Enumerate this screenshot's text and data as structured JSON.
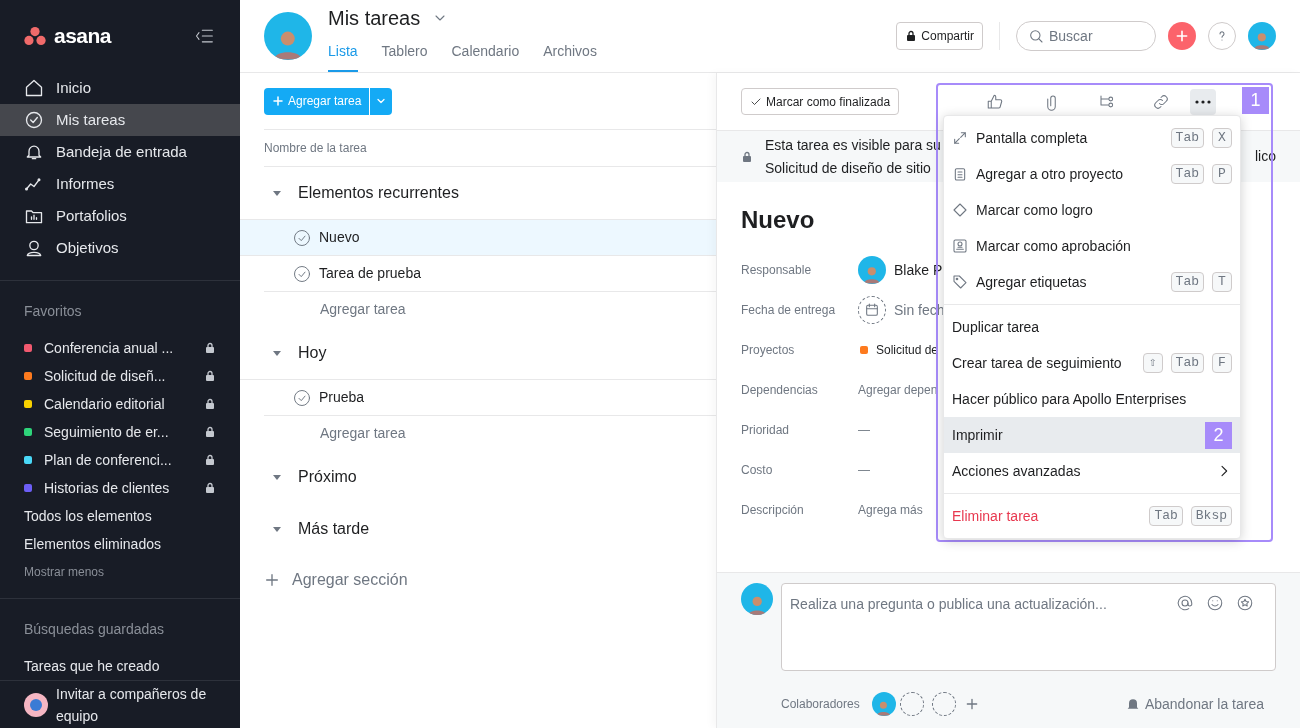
{
  "sidebar": {
    "logo": "asana",
    "nav": [
      {
        "label": "Inicio",
        "selected": false
      },
      {
        "label": "Mis tareas",
        "selected": true
      },
      {
        "label": "Bandeja de entrada",
        "selected": false
      },
      {
        "label": "Informes",
        "selected": false
      },
      {
        "label": "Portafolios",
        "selected": false
      },
      {
        "label": "Objetivos",
        "selected": false
      }
    ],
    "favorites_title": "Favoritos",
    "favorites": [
      {
        "label": "Conferencia anual ...",
        "color": "#f1596f"
      },
      {
        "label": "Solicitud de diseñ...",
        "color": "#fd7a1e"
      },
      {
        "label": "Calendario editorial",
        "color": "#f8d100"
      },
      {
        "label": "Seguimiento de er...",
        "color": "#2ed47a"
      },
      {
        "label": "Plan de conferenci...",
        "color": "#4ad8f7"
      },
      {
        "label": "Historias de clientes",
        "color": "#6c5ef6"
      }
    ],
    "links": [
      "Todos los elementos",
      "Elementos eliminados"
    ],
    "show_less": "Mostrar menos",
    "saved_title": "Búsquedas guardadas",
    "saved": [
      "Tareas que he creado"
    ],
    "invite": "Invitar a compañeros de equipo"
  },
  "header": {
    "title": "Mis tareas",
    "tabs": [
      {
        "label": "Lista",
        "selected": true
      },
      {
        "label": "Tablero",
        "selected": false
      },
      {
        "label": "Calendario",
        "selected": false
      },
      {
        "label": "Archivos",
        "selected": false
      }
    ],
    "share": "Compartir",
    "search": {
      "placeholder": "Buscar"
    }
  },
  "list": {
    "add_button": "Agregar tarea",
    "column": "Nombre de la tarea",
    "add_section": "Agregar sección",
    "sections": [
      {
        "title": "Elementos recurrentes",
        "tasks": [
          {
            "name": "Nuevo",
            "selected": true
          },
          {
            "name": "Tarea de prueba",
            "selected": false
          }
        ],
        "add_task": "Agregar tarea"
      },
      {
        "title": "Hoy",
        "tasks": [
          {
            "name": "Prueba",
            "selected": false
          }
        ],
        "add_task": "Agregar tarea"
      },
      {
        "title": "Próximo"
      },
      {
        "title": "Más tarde"
      }
    ]
  },
  "detail": {
    "complete_button": "Marcar como finalizada",
    "banner": [
      "Esta tarea es visible para su",
      "Solicitud de diseño de sitio"
    ],
    "banner_tail": "lico",
    "title": "Nuevo",
    "fields": [
      {
        "label": "Responsable",
        "kind": "user",
        "value": "Blake P"
      },
      {
        "label": "Fecha de entrega",
        "kind": "date",
        "value": "Sin fech"
      },
      {
        "label": "Proyectos",
        "kind": "project",
        "value": "Solicitud de",
        "color": "#fd7a1e"
      },
      {
        "label": "Dependencias",
        "kind": "text",
        "value": "Agregar depen"
      },
      {
        "label": "Prioridad",
        "kind": "dash",
        "value": "—"
      },
      {
        "label": "Costo",
        "kind": "dash",
        "value": "—"
      },
      {
        "label": "Descripción",
        "kind": "text",
        "value": "Agrega más"
      }
    ],
    "comment": {
      "placeholder": "Realiza una pregunta o publica una actualización..."
    },
    "collaborators": "Colaboradores",
    "leave": "Abandonar la tarea"
  },
  "menu": {
    "callout": "1",
    "groups": [
      {
        "items": [
          {
            "label": "Pantalla completa",
            "keys": [
              "Tab",
              "X"
            ],
            "selected": false,
            "kind": "normal"
          },
          {
            "label": "Agregar a otro proyecto",
            "keys": [
              "Tab",
              "P"
            ],
            "selected": false,
            "kind": "normal"
          },
          {
            "label": "Marcar como logro",
            "selected": false,
            "kind": "normal"
          },
          {
            "label": "Marcar como aprobación",
            "selected": false,
            "kind": "normal"
          },
          {
            "label": "Agregar etiquetas",
            "keys": [
              "Tab",
              "T"
            ],
            "selected": false,
            "kind": "normal"
          }
        ]
      },
      {
        "items": [
          {
            "label": "Duplicar tarea",
            "selected": false,
            "kind": "normal"
          },
          {
            "label": "Crear tarea de seguimiento",
            "keys": [
              "⇧",
              "Tab",
              "F"
            ],
            "selected": false,
            "kind": "normal"
          },
          {
            "label": "Hacer público para Apollo Enterprises",
            "selected": false,
            "kind": "normal"
          },
          {
            "label": "Imprimir",
            "selected": true,
            "kind": "normal",
            "callout": "2"
          },
          {
            "label": "Acciones avanzadas",
            "selected": false,
            "kind": "submenu"
          }
        ]
      },
      {
        "items": [
          {
            "label": "Eliminar tarea",
            "keys": [
              "Tab",
              "Bksp"
            ],
            "selected": false,
            "kind": "danger"
          }
        ]
      }
    ]
  }
}
